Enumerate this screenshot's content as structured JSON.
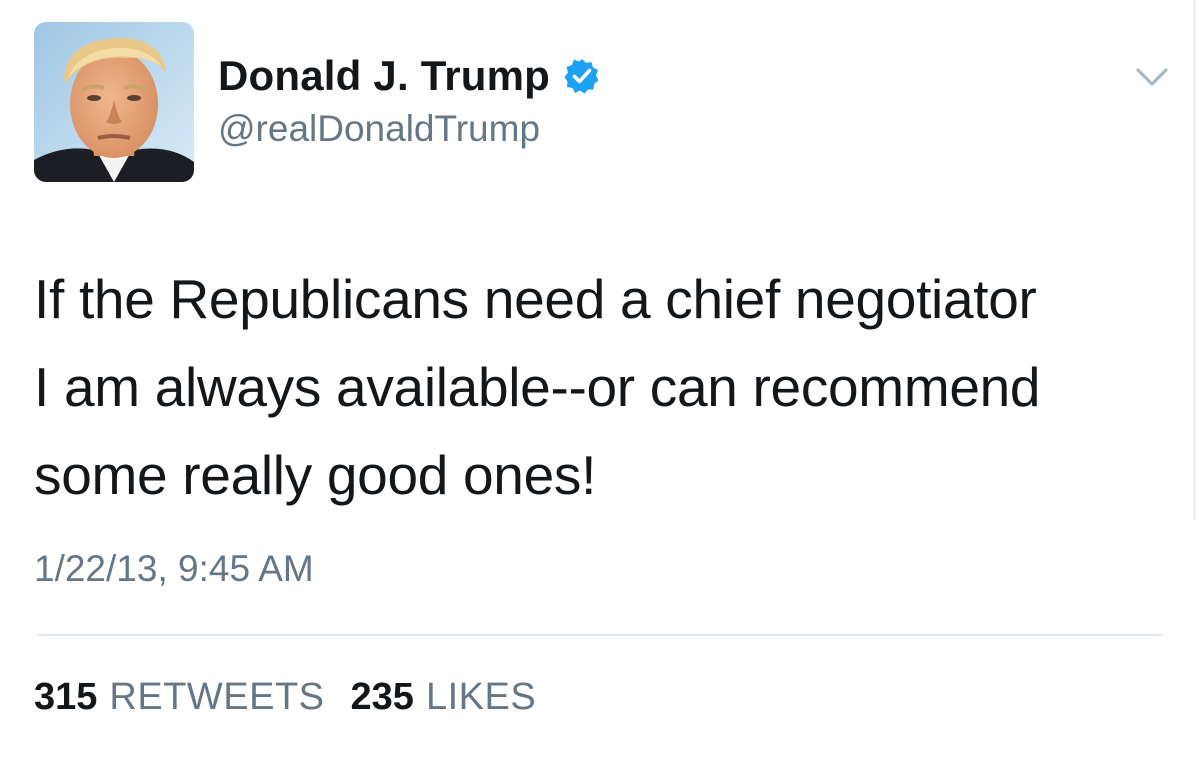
{
  "author": {
    "display_name": "Donald J. Trump",
    "handle": "@realDonaldTrump",
    "verified": true,
    "verified_icon": "verified-badge-icon",
    "avatar_icon": "profile-photo"
  },
  "menu": {
    "icon": "chevron-down-icon"
  },
  "tweet": {
    "lines": [
      "If the Republicans need a chief negotiator",
      "I am always available--or can recommend",
      "some really good ones!"
    ],
    "timestamp": "1/22/13, 9:45 AM"
  },
  "stats": {
    "retweets_count": "315",
    "retweets_label": "RETWEETS",
    "likes_count": "235",
    "likes_label": "LIKES"
  },
  "colors": {
    "text": "#14171a",
    "secondary": "#657786",
    "verified_blue": "#1da1f2",
    "divider": "#e1e8ed"
  }
}
